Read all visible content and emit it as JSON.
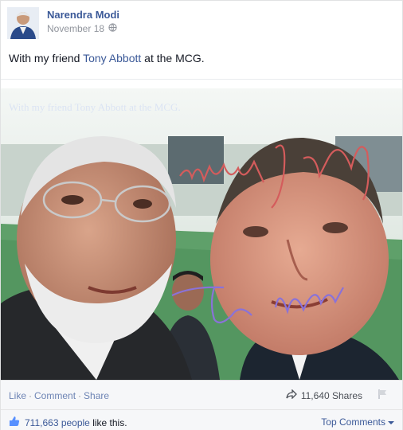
{
  "post": {
    "author": "Narendra Modi",
    "date": "November 18",
    "caption_prefix": "With my friend ",
    "caption_link": "Tony Abbott",
    "caption_suffix": " at the MCG."
  },
  "footer": {
    "like": "Like",
    "comment": "Comment",
    "share": "Share",
    "shares_count": "11,640 Shares",
    "likes_count": "711,663 people",
    "likes_suffix": " like this.",
    "top_comments": "Top Comments"
  },
  "icons": [
    "globe-icon",
    "share-arrow-icon",
    "flag-icon",
    "thumbs-up-icon",
    "dropdown-arrow-icon"
  ],
  "colors": {
    "link": "#3b5998",
    "muted": "#90949c",
    "footer_bg": "#f6f7f9"
  }
}
